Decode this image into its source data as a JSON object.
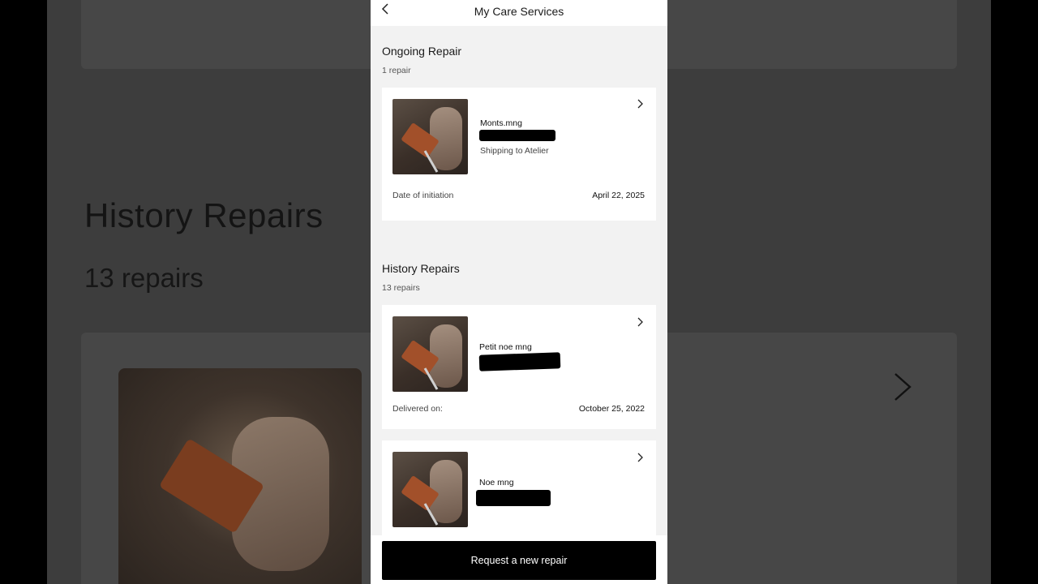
{
  "backdrop": {
    "section_title": "History Repairs",
    "section_count": "13 repairs"
  },
  "header": {
    "title": "My Care Services",
    "back_icon": "chevron-left-icon"
  },
  "ongoing": {
    "title": "Ongoing Repair",
    "count": "1 repair",
    "items": [
      {
        "name": "Monts.mng",
        "status": "Shipping to Atelier",
        "date_label": "Date of initiation",
        "date_value": "April 22, 2025"
      }
    ]
  },
  "history": {
    "title": "History Repairs",
    "count": "13 repairs",
    "items": [
      {
        "name": "Petit noe mng",
        "date_label": "Delivered on:",
        "date_value": "October 25, 2022"
      },
      {
        "name": "Noe mng"
      }
    ]
  },
  "footer": {
    "cta_label": "Request a new repair"
  },
  "icons": {
    "chevron_right": "chevron-right-icon"
  }
}
